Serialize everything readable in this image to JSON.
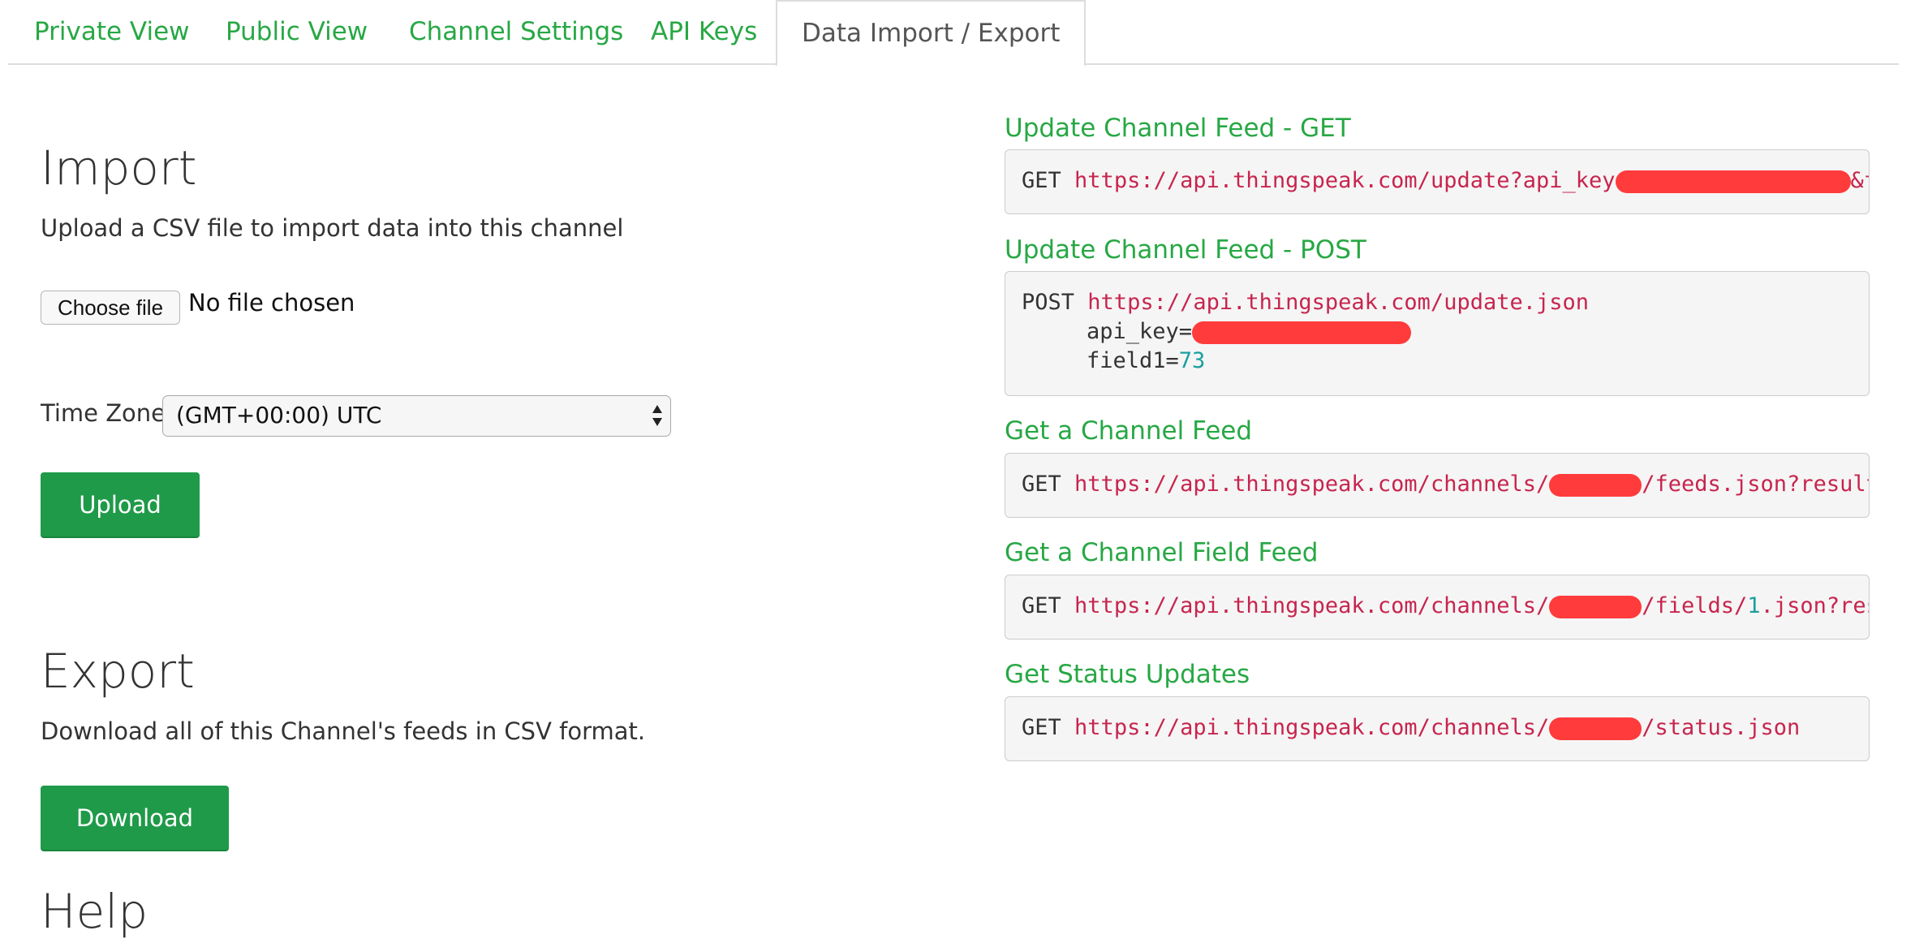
{
  "tabs": [
    {
      "label": "Private View",
      "active": false
    },
    {
      "label": "Public View",
      "active": false
    },
    {
      "label": "Channel Settings",
      "active": false
    },
    {
      "label": "API Keys",
      "active": false
    },
    {
      "label": "Data Import / Export",
      "active": true
    }
  ],
  "import": {
    "title": "Import",
    "description": "Upload a CSV file to import data into this channel",
    "choose_file_label": "Choose file",
    "file_status": "No file chosen",
    "timezone_label": "Time Zone",
    "timezone_value": "(GMT+00:00) UTC",
    "upload_label": "Upload"
  },
  "export": {
    "title": "Export",
    "description": "Download all of this Channel's feeds in CSV format.",
    "download_label": "Download"
  },
  "help": {
    "title": "Help"
  },
  "api_requests": {
    "update_get": {
      "title": "Update Channel Feed - GET",
      "verb": "GET",
      "url_start": "https://api.thingspeak.com/update?api_key",
      "url_end": "&fie"
    },
    "update_post": {
      "title": "Update Channel Feed - POST",
      "verb": "POST",
      "url": "https://api.thingspeak.com/update.json",
      "param1_name": "api_key=",
      "param2_name": "field1=",
      "param2_value": "73"
    },
    "channel_feed": {
      "title": "Get a Channel Feed",
      "verb": "GET",
      "url_start": "https://api.thingspeak.com/channels/",
      "url_end": "/feeds.json?results="
    },
    "field_feed": {
      "title": "Get a Channel Field Feed",
      "verb": "GET",
      "url_start": "https://api.thingspeak.com/channels/",
      "url_mid": "/fields/",
      "field_number": "1",
      "url_end": ".json?resul"
    },
    "status_updates": {
      "title": "Get Status Updates",
      "verb": "GET",
      "url_start": "https://api.thingspeak.com/channels/",
      "url_end": "/status.json"
    }
  },
  "colors": {
    "link_green": "#28a745",
    "button_green": "#1f9a48",
    "code_url": "#c7254e",
    "code_number": "#1a9f9f",
    "redaction": "#ff3b3b"
  }
}
